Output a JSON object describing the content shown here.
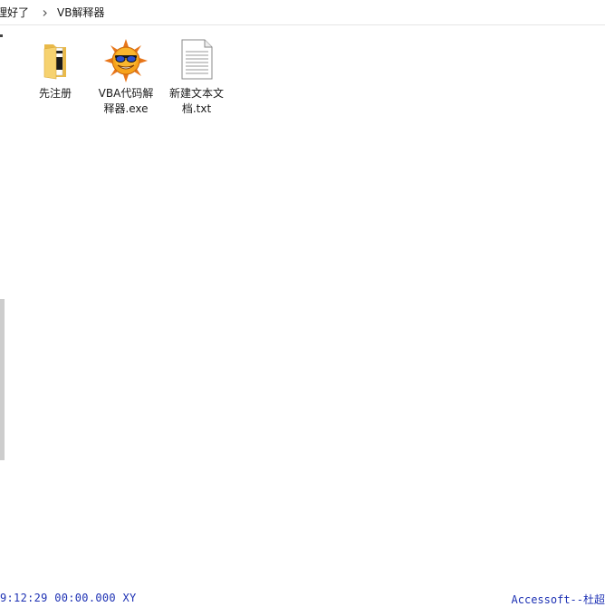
{
  "breadcrumb": {
    "parent": "理好了",
    "current": "VB解释器"
  },
  "files": [
    {
      "name": "先注册",
      "icon": "folder-icon"
    },
    {
      "name": "VBA代码解释器.exe",
      "icon": "sun-sunglasses-icon"
    },
    {
      "name": "新建文本文档.txt",
      "icon": "text-document-icon"
    }
  ],
  "status": {
    "left": "9:12:29 00:00.000 XY",
    "right": "Accessoft--杜超"
  },
  "colors": {
    "status_text": "#1e32b4",
    "folder": "#f6d270",
    "sun": "#f7a21b"
  }
}
